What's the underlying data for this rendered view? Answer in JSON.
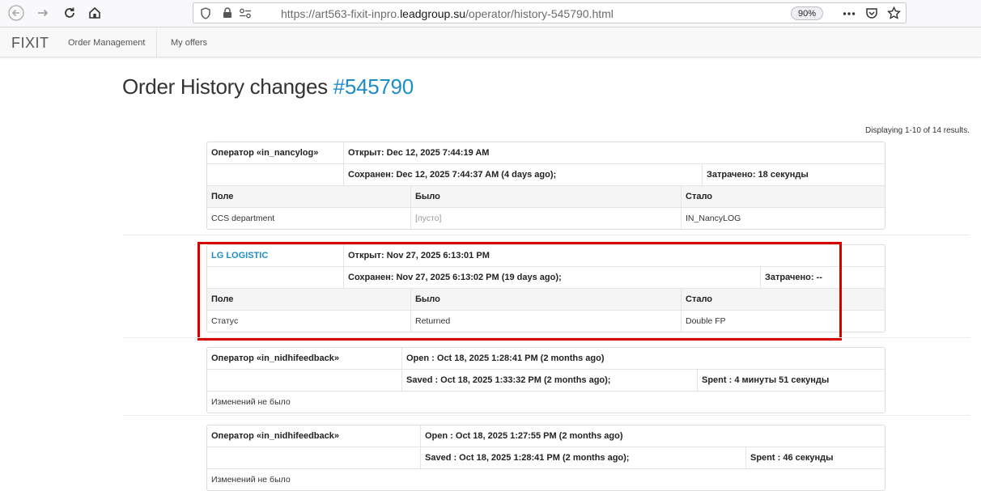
{
  "browser": {
    "url_prefix": "https://art563-fixit-inpro.",
    "url_host": "leadgroup.su",
    "url_path": "/operator/history-545790.html",
    "zoom": "90%"
  },
  "nav": {
    "brand": "FIXIT",
    "items": [
      "Order Management",
      "My offers"
    ]
  },
  "page": {
    "title": "Order History changes",
    "order_id": "#545790",
    "summary": "Displaying 1-10 of 14 results."
  },
  "entries": [
    {
      "operator": "Оператор «in_nancylog»",
      "opened": "Открыт: Dec 12, 2025 7:44:19 AM",
      "saved": "Сохранен: Dec 12, 2025 7:44:37 AM (4 days ago);",
      "spent": "Затрачено: 18 секунды",
      "headers": [
        "Поле",
        "Было",
        "Стало"
      ],
      "rows": [
        [
          "CCS department",
          "[пусто]",
          "IN_NancyLOG"
        ]
      ]
    },
    {
      "operator": "LG LOGISTIC",
      "opened": "Открыт: Nov 27, 2025 6:13:01 PM",
      "saved": "Сохранен: Nov 27, 2025 6:13:02 PM (19 days ago);",
      "spent": "Затрачено: --",
      "headers": [
        "Поле",
        "Было",
        "Стало"
      ],
      "rows": [
        [
          "Статус",
          "Returned",
          "Double FP"
        ]
      ]
    },
    {
      "operator": "Оператор «in_nidhifeedback»",
      "opened": "Open : Oct 18, 2025 1:28:41 PM (2 months ago)",
      "saved": "Saved : Oct 18, 2025 1:33:32 PM (2 months ago);",
      "spent": "Spent : 4 минуты 51 секунды",
      "no_changes": "Изменений не было"
    },
    {
      "operator": "Оператор «in_nidhifeedback»",
      "opened": "Open : Oct 18, 2025 1:27:55 PM (2 months ago)",
      "saved": "Saved : Oct 18, 2025 1:28:41 PM (2 months ago);",
      "spent": "Spent : 46 секунды",
      "no_changes": "Изменений не было"
    }
  ],
  "colors": {
    "accent": "#1e8dc7",
    "highlight": "#d60000"
  }
}
